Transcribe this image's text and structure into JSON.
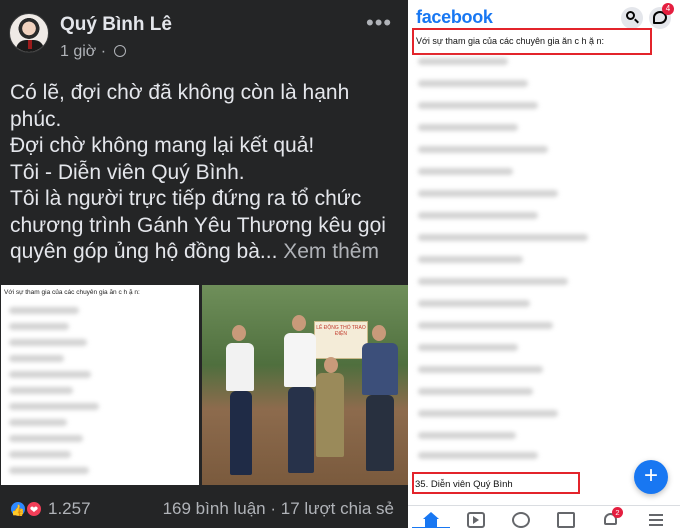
{
  "post": {
    "author": "Quý Bình Lê",
    "time": "1 giờ ·",
    "more": "•••",
    "text_lines": [
      "Có lẽ, đợi chờ đã không còn là hạnh",
      "phúc.",
      "Đợi chờ không mang lại kết quả!",
      "Tôi - Diễn viên Quý Bình.",
      "Tôi là người trực tiếp đứng ra tổ chức",
      "chương trình Gánh Yêu Thương kêu gọi",
      "quyên góp ủng hộ đồng bà..."
    ],
    "see_more": "Xem thêm",
    "document_caption": "Với sự tham gia của các chuyên gia ăn c h ặ n:",
    "banner_text": "LỄ ĐỘNG THỔ TRAO ĐIỆN",
    "reaction_count": "1.257",
    "stats": "169 bình luận · 17 lượt chia sẻ"
  },
  "mobile": {
    "logo": "facebook",
    "messenger_badge": "4",
    "notification_badge": "2",
    "highlight_top": "Với sự tham gia của các chuyên gia ăn c h ặ n:",
    "highlight_bottom": "35. Diễn viên Quý Bình",
    "fab_symbol": "+"
  },
  "colors": {
    "dark_bg": "#242526",
    "fb_blue": "#1877f2",
    "highlight_red": "#e3242b",
    "love_red": "#f33e58"
  },
  "icons": [
    "globe-icon",
    "more-icon",
    "like-icon",
    "love-icon",
    "search-icon",
    "messenger-icon",
    "home-icon",
    "video-icon",
    "groups-icon",
    "news-icon",
    "bell-icon",
    "menu-icon",
    "plus-icon"
  ]
}
